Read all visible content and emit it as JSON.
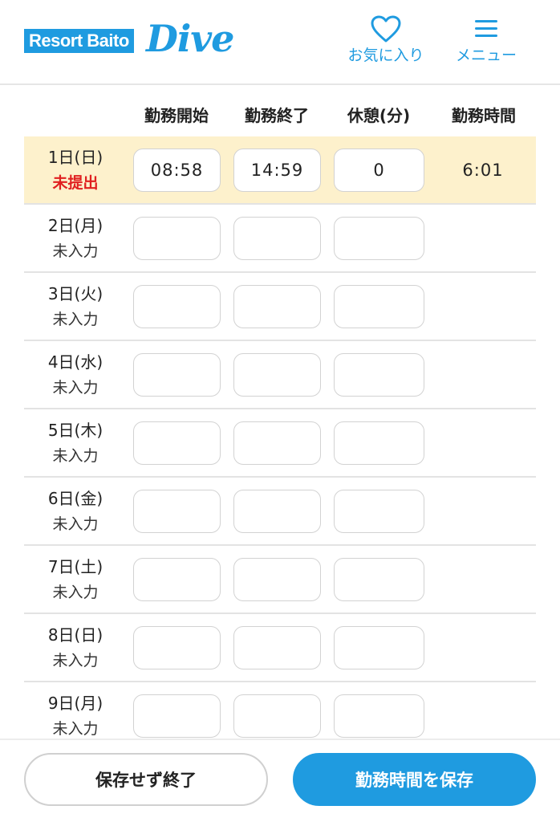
{
  "header": {
    "logo_text": "Resort Baito",
    "logo_script": "Dive",
    "favorites_label": "お気に入り",
    "menu_label": "メニュー",
    "favorites_icon": "heart-icon",
    "menu_icon": "hamburger-menu-icon"
  },
  "table": {
    "columns": [
      "勤務開始",
      "勤務終了",
      "休憩(分)",
      "勤務時間"
    ],
    "rows": [
      {
        "date": "1日(日)",
        "status": "未提出",
        "start": "08:58",
        "end": "14:59",
        "break": "0",
        "hours": "6:01"
      },
      {
        "date": "2日(月)",
        "status": "未入力",
        "start": "",
        "end": "",
        "break": "",
        "hours": ""
      },
      {
        "date": "3日(火)",
        "status": "未入力",
        "start": "",
        "end": "",
        "break": "",
        "hours": ""
      },
      {
        "date": "4日(水)",
        "status": "未入力",
        "start": "",
        "end": "",
        "break": "",
        "hours": ""
      },
      {
        "date": "5日(木)",
        "status": "未入力",
        "start": "",
        "end": "",
        "break": "",
        "hours": ""
      },
      {
        "date": "6日(金)",
        "status": "未入力",
        "start": "",
        "end": "",
        "break": "",
        "hours": ""
      },
      {
        "date": "7日(土)",
        "status": "未入力",
        "start": "",
        "end": "",
        "break": "",
        "hours": ""
      },
      {
        "date": "8日(日)",
        "status": "未入力",
        "start": "",
        "end": "",
        "break": "",
        "hours": ""
      },
      {
        "date": "9日(月)",
        "status": "未入力",
        "start": "",
        "end": "",
        "break": "",
        "hours": ""
      }
    ]
  },
  "footer": {
    "discard_label": "保存せず終了",
    "save_label": "勤務時間を保存"
  },
  "colors": {
    "brand": "#1f9be0",
    "highlight_row": "#fdf1cc",
    "unsubmitted": "#e02020"
  }
}
